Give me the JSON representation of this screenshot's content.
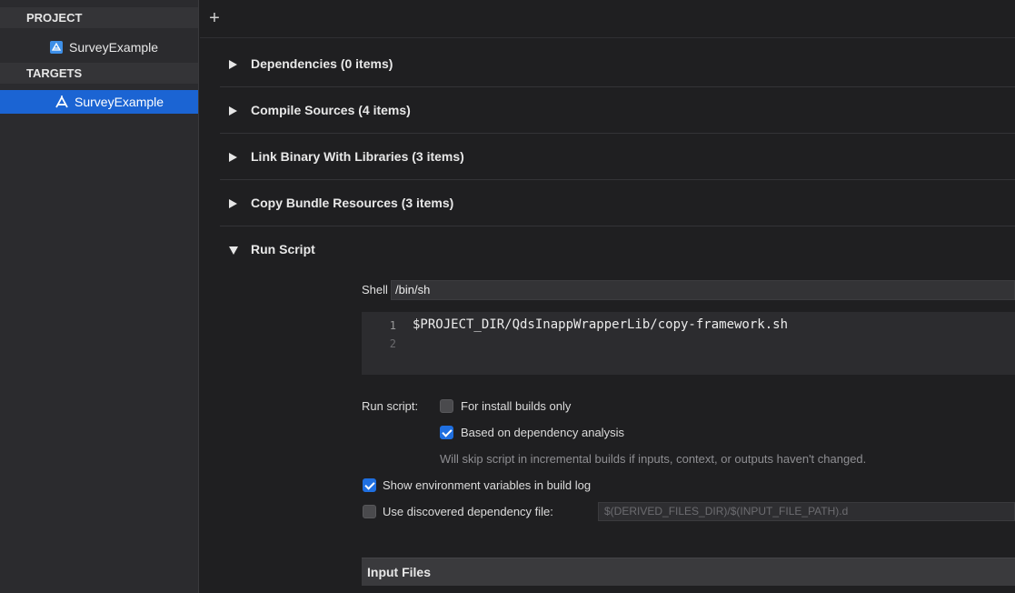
{
  "sidebar": {
    "project_header": "PROJECT",
    "project_item": "SurveyExample",
    "targets_header": "TARGETS",
    "target_item": "SurveyExample"
  },
  "toolbar": {
    "add_icon": "plus-icon"
  },
  "phases": [
    {
      "title": "Dependencies (0 items)",
      "expanded": false
    },
    {
      "title": "Compile Sources (4 items)",
      "expanded": false
    },
    {
      "title": "Link Binary With Libraries (3 items)",
      "expanded": false
    },
    {
      "title": "Copy Bundle Resources (3 items)",
      "expanded": false
    },
    {
      "title": "Run Script",
      "expanded": true
    }
  ],
  "run_script": {
    "shell_label": "Shell",
    "shell_value": "/bin/sh",
    "code_lines": [
      {
        "number": "1",
        "text": "$PROJECT_DIR/QdsInappWrapperLib/copy-framework.sh"
      },
      {
        "number": "2",
        "text": ""
      }
    ],
    "run_script_label": "Run script:",
    "install_builds_only": {
      "label": "For install builds only",
      "checked": false
    },
    "dependency_analysis": {
      "label": "Based on dependency analysis",
      "checked": true
    },
    "dependency_note": "Will skip script in incremental builds if inputs, context, or outputs haven't changed.",
    "show_env_vars": {
      "label": "Show environment variables in build log",
      "checked": true
    },
    "discovered_dep_file": {
      "label": "Use discovered dependency file:",
      "checked": false
    },
    "dep_file_placeholder": "$(DERIVED_FILES_DIR)/$(INPUT_FILE_PATH).d",
    "input_files_header": "Input Files"
  },
  "colors": {
    "selection": "#1b64d3",
    "checkbox_checked": "#1f6fe0",
    "background": "#1f1f21"
  }
}
